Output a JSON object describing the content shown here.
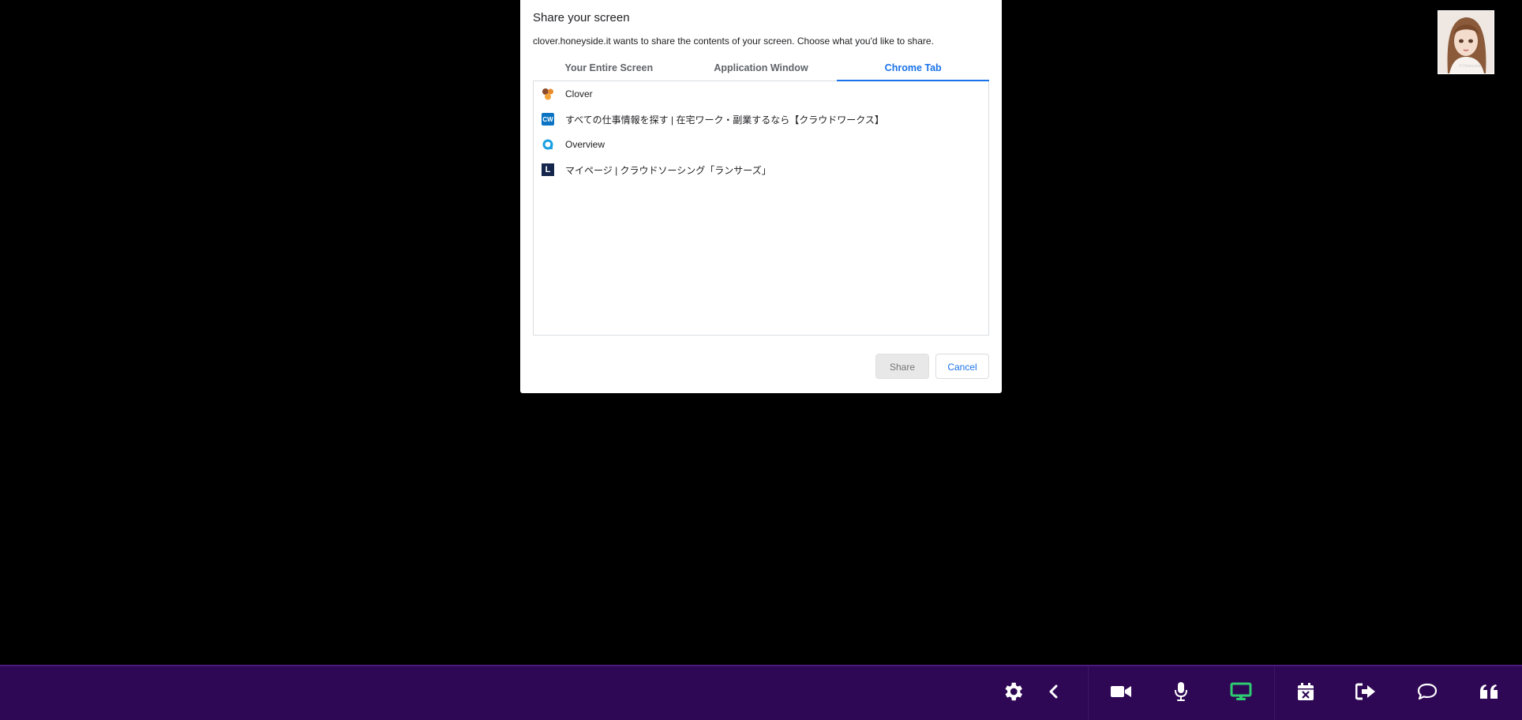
{
  "dialog": {
    "title": "Share your screen",
    "subtitle": "clover.honeyside.it wants to share the contents of your screen. Choose what you'd like to share.",
    "tabs": [
      {
        "label": "Your Entire Screen",
        "active": false
      },
      {
        "label": "Application Window",
        "active": false
      },
      {
        "label": "Chrome Tab",
        "active": true
      }
    ],
    "items": [
      {
        "label": "Clover",
        "icon": "clover-favicon-icon"
      },
      {
        "label": "すべての仕事情報を探す | 在宅ワーク・副業するなら【クラウドワークス】",
        "icon": "crowdworks-favicon-icon",
        "icon_text": "CW"
      },
      {
        "label": "Overview",
        "icon": "overview-favicon-icon"
      },
      {
        "label": "マイページ | クラウドソーシング「ランサーズ」",
        "icon": "lancers-favicon-icon",
        "icon_text": "L"
      }
    ],
    "share_label": "Share",
    "cancel_label": "Cancel"
  },
  "avatar": {
    "watermark": "© Honeyside"
  },
  "toolbar": {
    "buttons": [
      {
        "name": "settings",
        "icon": "gear-icon"
      },
      {
        "name": "collapse",
        "icon": "chevron-left-icon"
      },
      {
        "name": "video",
        "icon": "video-camera-icon"
      },
      {
        "name": "microphone",
        "icon": "microphone-icon"
      },
      {
        "name": "screen-share",
        "icon": "monitor-icon",
        "active": true
      },
      {
        "name": "calendar",
        "icon": "calendar-x-icon"
      },
      {
        "name": "leave",
        "icon": "sign-out-icon"
      },
      {
        "name": "chat",
        "icon": "chat-bubble-icon"
      },
      {
        "name": "quote",
        "icon": "quote-icon"
      }
    ]
  },
  "colors": {
    "accent": "#1a73e8",
    "toolbar_bg": "#2e0854",
    "icon_white": "#ffffff",
    "active_green": "#2ecc71"
  }
}
